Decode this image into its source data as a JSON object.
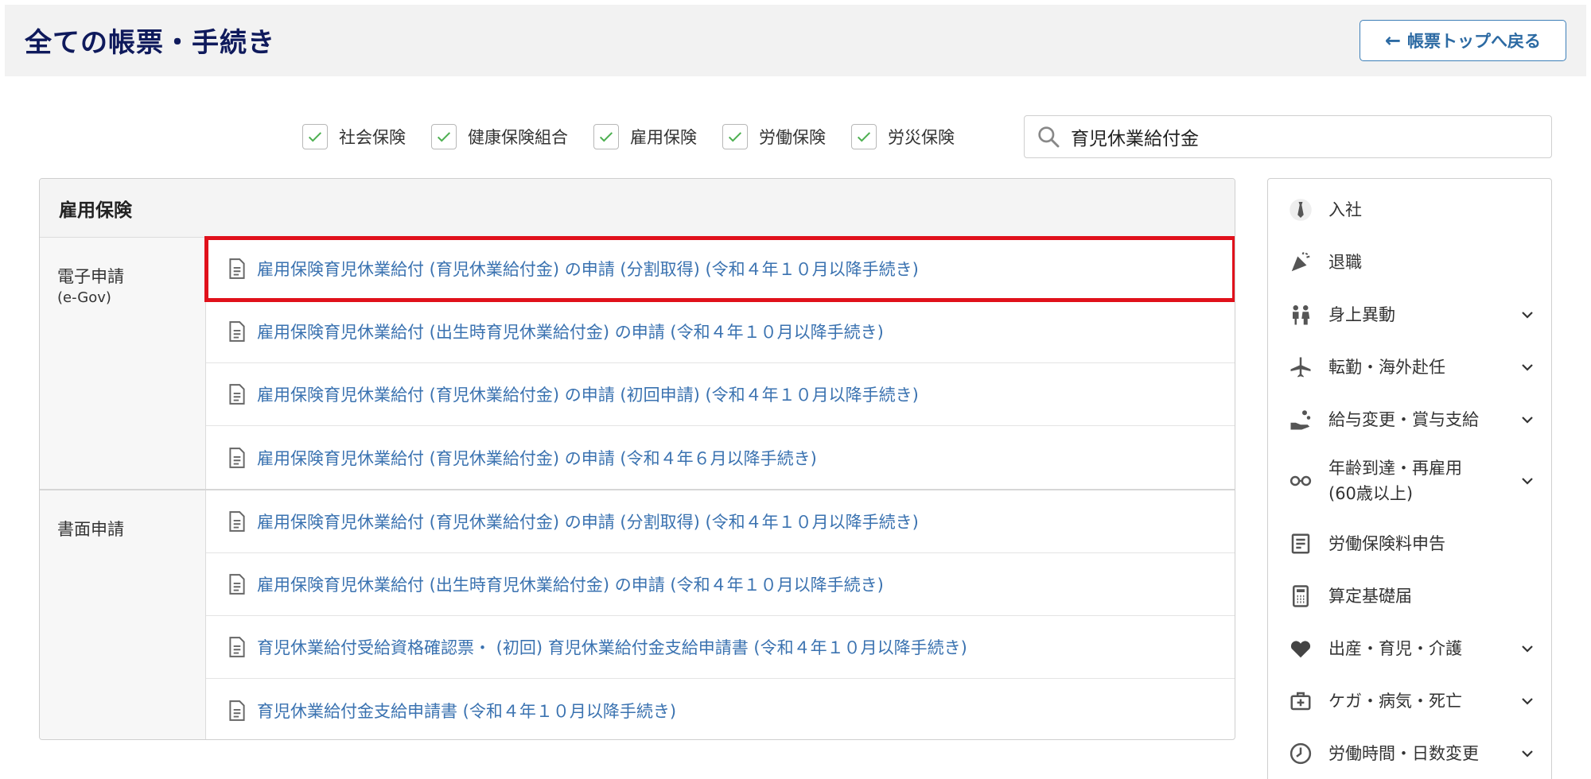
{
  "header": {
    "title": "全ての帳票・手続き",
    "back_button": "帳票トップへ戻る"
  },
  "filters": [
    {
      "label": "社会保険",
      "checked": true
    },
    {
      "label": "健康保険組合",
      "checked": true
    },
    {
      "label": "雇用保険",
      "checked": true
    },
    {
      "label": "労働保険",
      "checked": true
    },
    {
      "label": "労災保険",
      "checked": true
    }
  ],
  "search": {
    "value": "育児休業給付金"
  },
  "panel": {
    "title": "雇用保険",
    "sections": [
      {
        "label": "電子申請",
        "sublabel": "(e-Gov)",
        "items": [
          "雇用保険育児休業給付 (育児休業給付金) の申請 (分割取得) (令和４年１０月以降手続き)",
          "雇用保険育児休業給付 (出生時育児休業給付金) の申請 (令和４年１０月以降手続き)",
          "雇用保険育児休業給付 (育児休業給付金) の申請 (初回申請) (令和４年１０月以降手続き)",
          "雇用保険育児休業給付 (育児休業給付金) の申請 (令和４年６月以降手続き)"
        ]
      },
      {
        "label": "書面申請",
        "sublabel": "",
        "items": [
          "雇用保険育児休業給付 (育児休業給付金) の申請 (分割取得) (令和４年１０月以降手続き)",
          "雇用保険育児休業給付 (出生時育児休業給付金) の申請 (令和４年１０月以降手続き)",
          "育児休業給付受給資格確認票・ (初回) 育児休業給付金支給申請書 (令和４年１０月以降手続き)",
          "育児休業給付金支給申請書 (令和４年１０月以降手続き)"
        ]
      }
    ]
  },
  "sidebar": {
    "items": [
      {
        "label": "入社",
        "icon": "necktie-icon",
        "expandable": false
      },
      {
        "label": "退職",
        "icon": "party-popper-icon",
        "expandable": false
      },
      {
        "label": "身上異動",
        "icon": "people-icon",
        "expandable": true
      },
      {
        "label": "転勤・海外赴任",
        "icon": "airplane-icon",
        "expandable": true
      },
      {
        "label": "給与変更・賞与支給",
        "icon": "hand-coins-icon",
        "expandable": true
      },
      {
        "label": "年齢到達・再雇用",
        "label2": "(60歳以上)",
        "icon": "glasses-icon",
        "expandable": true
      },
      {
        "label": "労働保険料申告",
        "icon": "document-lines-icon",
        "expandable": false
      },
      {
        "label": "算定基礎届",
        "icon": "calculator-icon",
        "expandable": false
      },
      {
        "label": "出産・育児・介護",
        "icon": "heart-icon",
        "expandable": true
      },
      {
        "label": "ケガ・病気・死亡",
        "icon": "first-aid-kit-icon",
        "expandable": true
      },
      {
        "label": "労働時間・日数変更",
        "icon": "clock-icon",
        "expandable": true
      }
    ]
  },
  "colors": {
    "title": "#0f1a5c",
    "link": "#3a72b0",
    "highlight": "#e0111b",
    "check": "#4caf50"
  }
}
